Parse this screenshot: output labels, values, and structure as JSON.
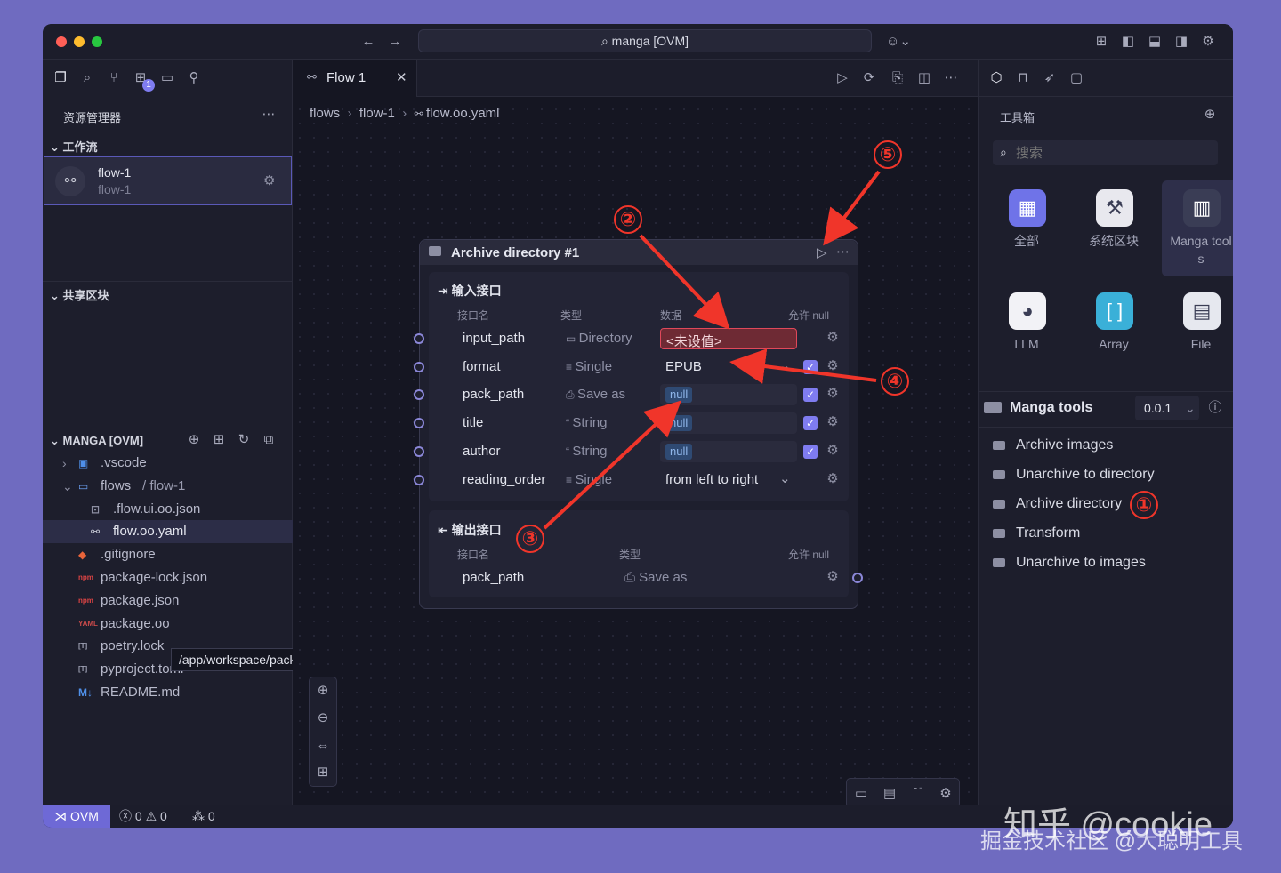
{
  "window": {
    "title": "manga [OVM]"
  },
  "explorer": {
    "header": "资源管理器",
    "workspace_section": "工作流",
    "flow_item": {
      "title": "flow-1",
      "subtitle": "flow-1"
    },
    "shared_section": "共享区块",
    "project_section": "MANGA [OVM]",
    "tree": [
      {
        "label": ".vscode",
        "icon": "vscode"
      },
      {
        "label": "flows",
        "suffix": "/ flow-1",
        "icon": "folder"
      },
      {
        "label": ".flow.ui.oo.json",
        "icon": "json-ui"
      },
      {
        "label": "flow.oo.yaml",
        "icon": "flow"
      },
      {
        "label": ".gitignore",
        "icon": "git"
      },
      {
        "label": "package-lock.json",
        "icon": "npm"
      },
      {
        "label": "package.json",
        "icon": "npm"
      },
      {
        "label": "package.oo",
        "icon": "yaml"
      },
      {
        "label": "poetry.lock",
        "icon": "toml"
      },
      {
        "label": "pyproject.toml",
        "icon": "toml"
      },
      {
        "label": "README.md",
        "icon": "markdown"
      }
    ],
    "tooltip": "/app/workspace/package.json"
  },
  "editor": {
    "tab_label": "Flow 1",
    "breadcrumb": [
      "flows",
      "flow-1",
      "flow.oo.yaml"
    ]
  },
  "node": {
    "title": "Archive directory #1",
    "inputs_label": "输入接口",
    "outputs_label": "输出接口",
    "columns": {
      "name": "接口名",
      "type": "类型",
      "data": "数据",
      "nullable": "允许 null"
    },
    "inputs": [
      {
        "name": "input_path",
        "type": "Directory",
        "value": "<未设值>",
        "kind": "error",
        "nullable": false
      },
      {
        "name": "format",
        "type": "Single",
        "value": "EPUB",
        "kind": "select",
        "nullable": true
      },
      {
        "name": "pack_path",
        "type": "Save as",
        "value": "null",
        "kind": "null",
        "nullable": true
      },
      {
        "name": "title",
        "type": "String",
        "value": "null",
        "kind": "null",
        "nullable": true
      },
      {
        "name": "author",
        "type": "String",
        "value": "null",
        "kind": "null",
        "nullable": true
      },
      {
        "name": "reading_order",
        "type": "Single",
        "value": "from left to right",
        "kind": "select",
        "nullable": false
      }
    ],
    "outputs": [
      {
        "name": "pack_path",
        "type": "Save as"
      }
    ]
  },
  "toolbox": {
    "header": "工具箱",
    "search_placeholder": "搜索",
    "tiles": [
      {
        "label": "全部",
        "icon": "grid-icon",
        "color": "#6f73e8"
      },
      {
        "label": "系统区块",
        "icon": "tools-icon",
        "color": "#e8e8ee"
      },
      {
        "label": "Manga tool",
        "label2": "s",
        "icon": "manga-icon",
        "color": "#3a3d55"
      },
      {
        "label": "LLM",
        "icon": "llm-icon",
        "color": "#f2f2f6"
      },
      {
        "label": "Array",
        "icon": "array-icon",
        "color": "#3ab0d8"
      },
      {
        "label": "File",
        "icon": "file-icon",
        "color": "#e6e8ef"
      }
    ],
    "section_title": "Manga tools",
    "version": "0.0.1",
    "items": [
      "Archive images",
      "Unarchive to directory",
      "Archive directory",
      "Transform",
      "Unarchive to images"
    ]
  },
  "statusbar": {
    "env": "OVM",
    "errors": "0",
    "warnings": "0",
    "ports": "0"
  },
  "annotations": [
    "①",
    "②",
    "③",
    "④",
    "⑤"
  ],
  "watermark": {
    "line1": "知乎 @cookie",
    "line2": "掘金技术社区 @大聪明工具"
  }
}
